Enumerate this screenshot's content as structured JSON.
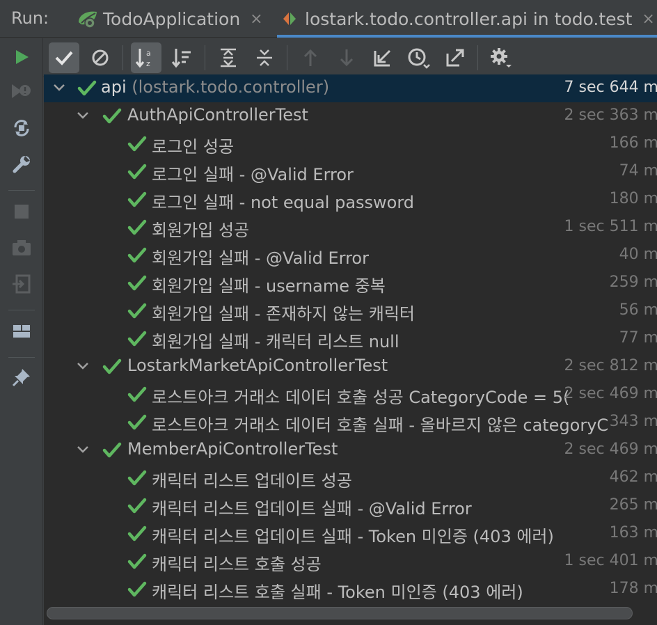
{
  "run_label": "Run:",
  "tabs": [
    {
      "label": "TodoApplication",
      "icon": "spring-boot-icon",
      "active": false
    },
    {
      "label": "lostark.todo.controller.api in todo.test",
      "icon": "test-config-icon",
      "active": true
    }
  ],
  "tab_close_glyph": "×",
  "colors": {
    "pass_green": "#5fb760",
    "run_green": "#4fa65b",
    "selection": "#0d293e",
    "tree_background": "#2b2b2b",
    "panel_background": "#3c3f41",
    "active_tab_underline": "#4a88c7"
  },
  "left_toolbar": [
    "run-icon",
    "rerun-failed-icon",
    "toggle-auto-test-icon",
    "settings-wrench-icon",
    "stop-icon",
    "snapshot-camera-icon",
    "exit-icon",
    "layout-icon",
    "pin-icon"
  ],
  "top_toolbar": [
    "show-passed-icon",
    "show-ignored-icon",
    "sort-alphabetically-icon",
    "sort-by-duration-icon",
    "expand-all-icon",
    "collapse-all-icon",
    "previous-failed-icon",
    "next-failed-icon",
    "import-tests-icon",
    "test-history-icon",
    "export-results-icon",
    "settings-gear-icon"
  ],
  "tree": {
    "root": {
      "name": "api",
      "package": "(lostark.todo.controller)",
      "time": "7 sec 644 m"
    },
    "classes": [
      {
        "name": "AuthApiControllerTest",
        "time": "2 sec 363 m",
        "tests": [
          {
            "name": "로그인 성공",
            "time": "166 m"
          },
          {
            "name": "로그인 실패 - @Valid Error",
            "time": "74 m"
          },
          {
            "name": "로그인 실패 - not equal password",
            "time": "180 m"
          },
          {
            "name": "회원가입 성공",
            "time": "1 sec 511 m"
          },
          {
            "name": "회원가입 실패 - @Valid Error",
            "time": "40 m"
          },
          {
            "name": "회원가입 실패 - username 중복",
            "time": "259 m"
          },
          {
            "name": "회원가입 실패 - 존재하지 않는 캐릭터",
            "time": "56 m"
          },
          {
            "name": "회원가입 실패 - 캐릭터 리스트 null",
            "time": "77 m"
          }
        ]
      },
      {
        "name": "LostarkMarketApiControllerTest",
        "time": "2 sec 812 m",
        "tests": [
          {
            "name": "로스트아크 거래소 데이터 호출 성공 CategoryCode = 5(",
            "time": "2 sec 469 m"
          },
          {
            "name": "로스트아크 거래소 데이터 호출 실패 - 올바르지 않은 categoryC",
            "time": "343 m"
          }
        ]
      },
      {
        "name": "MemberApiControllerTest",
        "time": "2 sec 469 m",
        "tests": [
          {
            "name": "캐릭터 리스트 업데이트 성공",
            "time": "462 m"
          },
          {
            "name": "캐릭터 리스트 업데이트 실패 - @Valid Error",
            "time": "265 m"
          },
          {
            "name": "캐릭터 리스트 업데이트 실패 - Token 미인증 (403 에러)",
            "time": "163 m"
          },
          {
            "name": "캐릭터 리스트 호출 성공",
            "time": "1 sec 401 m"
          },
          {
            "name": "캐릭터 리스트 호출 실패 - Token 미인증 (403 에러)",
            "time": "178 m"
          }
        ]
      }
    ]
  }
}
